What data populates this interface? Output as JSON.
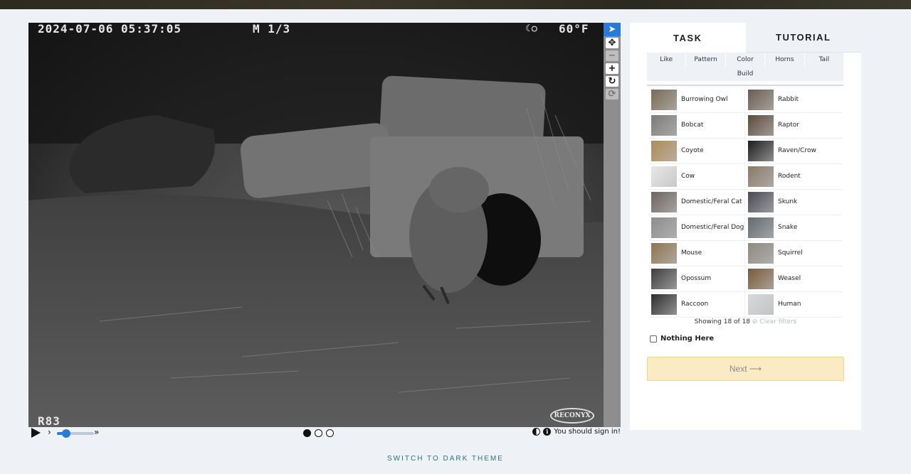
{
  "camera": {
    "timestamp": "2024-07-06 05:37:05",
    "frame": "M 1/3",
    "moon_icon": "moon-phase-icon",
    "temperature": "60°F",
    "camera_id": "R83",
    "brand": "RECONYX"
  },
  "toolbar": {
    "tools": [
      "pointer-icon",
      "move-icon",
      "zoom-out-icon",
      "zoom-in-icon",
      "rotate-icon",
      "reset-icon"
    ],
    "pointer": "➤",
    "move": "✥",
    "zoom_out": "−",
    "zoom_in": "+",
    "rotate": "↻",
    "reset": "⟳"
  },
  "controls": {
    "play": "play-icon",
    "slow": "›",
    "fast": "»",
    "speed_level": 0.25,
    "frames": 3,
    "current_frame": 1,
    "sign_in_note": "You should sign in!"
  },
  "panel": {
    "tabs": {
      "task": "TASK",
      "tutorial": "TUTORIAL"
    },
    "filters": [
      "Like",
      "Pattern",
      "Color",
      "Horns",
      "Tail"
    ],
    "filter_build": "Build",
    "choices": [
      "Burrowing Owl",
      "Rabbit",
      "Bobcat",
      "Raptor",
      "Coyote",
      "Raven/Crow",
      "Cow",
      "Rodent",
      "Domestic/Feral Cat",
      "Skunk",
      "Domestic/Feral Dog",
      "Snake",
      "Mouse",
      "Squirrel",
      "Opossum",
      "Weasel",
      "Raccoon",
      "Human"
    ],
    "showing": "Showing 18 of 18",
    "clear_filters": "⊘ Clear filters",
    "nothing_here": "Nothing Here",
    "next": "Next ⟶"
  },
  "footer": {
    "dark_theme": "SWITCH TO DARK THEME"
  },
  "colors": {
    "accent": "#2b7bd6",
    "next_bg": "#faebc4",
    "footer_link": "#2b7480"
  }
}
